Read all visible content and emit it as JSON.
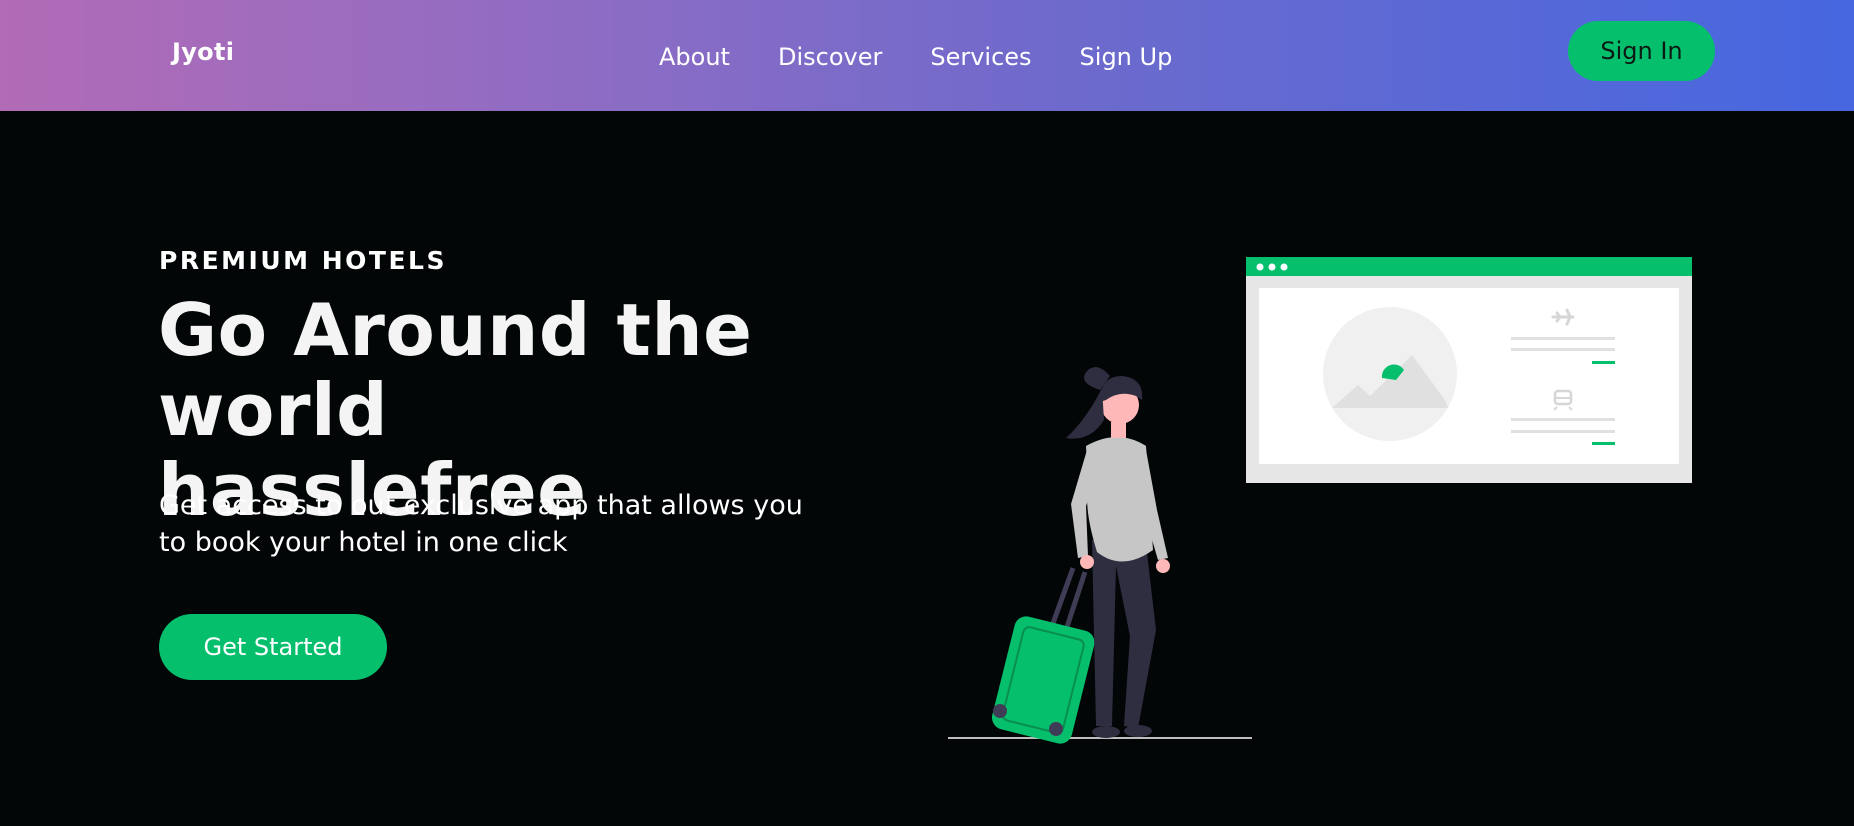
{
  "header": {
    "logo": "Jyoti",
    "nav": [
      {
        "label": "About"
      },
      {
        "label": "Discover"
      },
      {
        "label": "Services"
      },
      {
        "label": "Sign Up"
      }
    ],
    "signin_label": "Sign In"
  },
  "hero": {
    "eyebrow": "PREMIUM HOTELS",
    "headline_line1": "Go Around the",
    "headline_line2": "world hasslefree",
    "subtext_line1": "Get access to out exclusive app that allows you",
    "subtext_line2": "to book your hotel in one click",
    "cta_label": "Get Started"
  },
  "illustration": {
    "icons": [
      "airplane-icon",
      "train-icon",
      "mountain-image-icon"
    ]
  },
  "colors": {
    "accent": "#05bf6d",
    "background": "#020607",
    "gradient_start": "#b26bb6",
    "gradient_end": "#4667e0"
  }
}
